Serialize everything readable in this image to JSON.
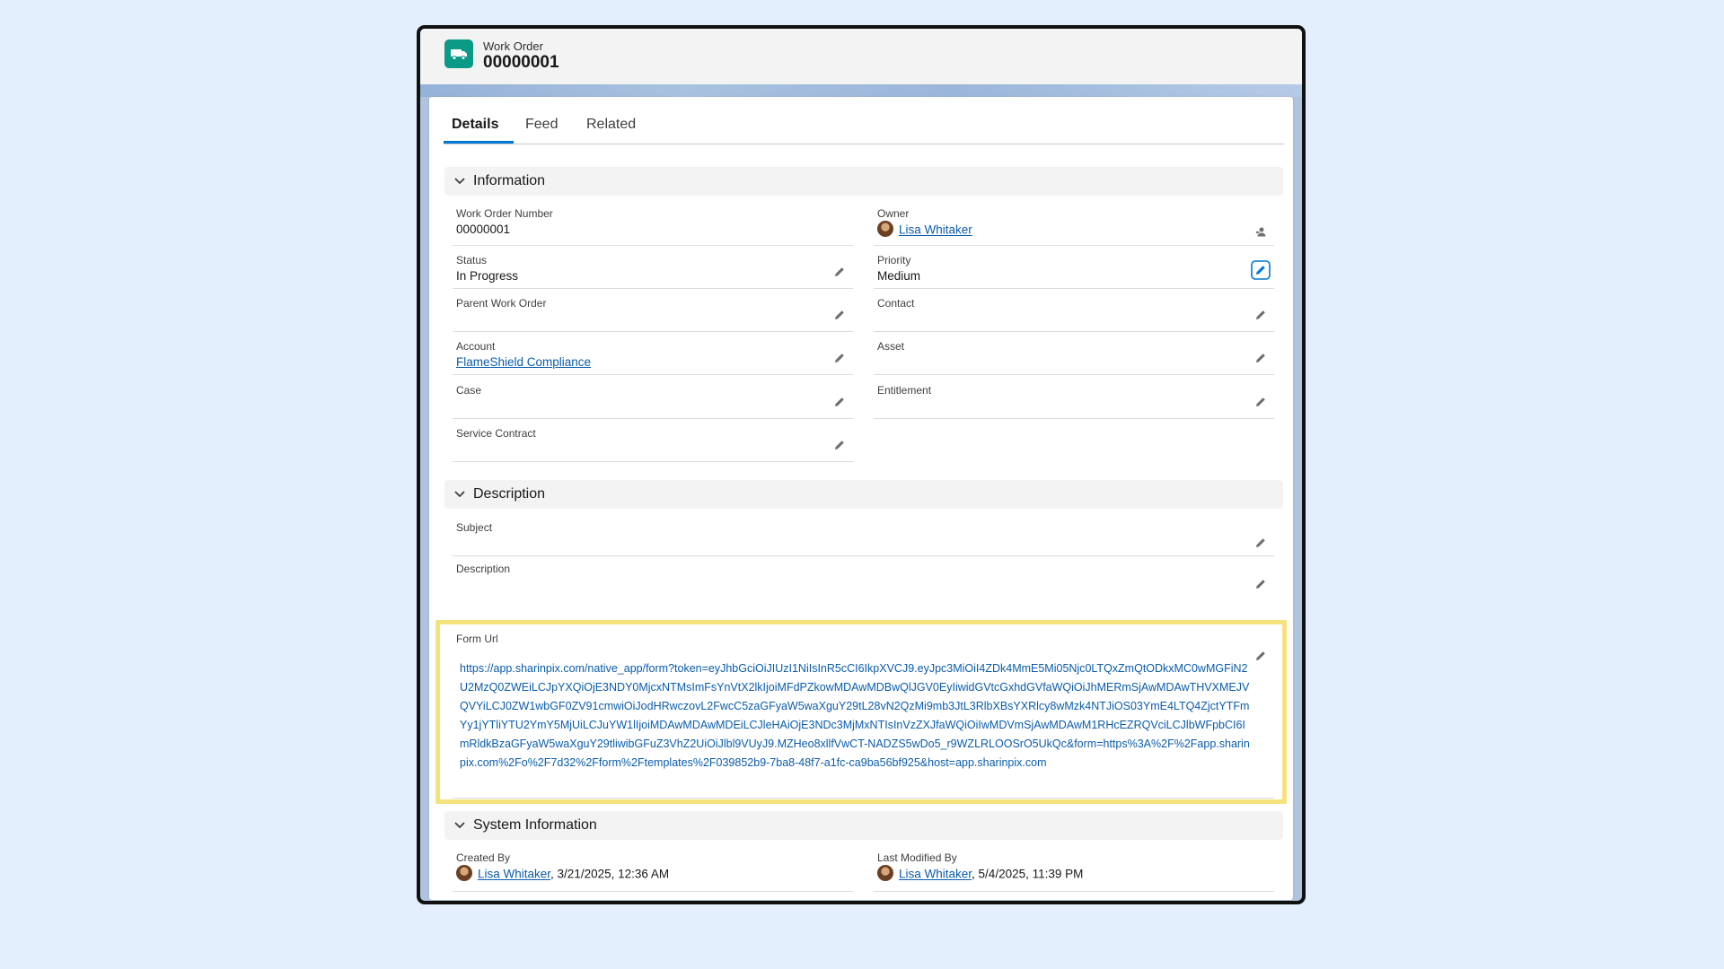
{
  "record": {
    "object_label": "Work Order",
    "title": "00000001"
  },
  "tabs": [
    "Details",
    "Feed",
    "Related"
  ],
  "sections": {
    "information": "Information",
    "description": "Description",
    "system": "System Information"
  },
  "fields": {
    "work_order_number": {
      "label": "Work Order Number",
      "value": "00000001"
    },
    "owner": {
      "label": "Owner",
      "value": "Lisa Whitaker"
    },
    "status": {
      "label": "Status",
      "value": "In Progress"
    },
    "priority": {
      "label": "Priority",
      "value": "Medium"
    },
    "parent_work_order": {
      "label": "Parent Work Order",
      "value": ""
    },
    "contact": {
      "label": "Contact",
      "value": ""
    },
    "account": {
      "label": "Account",
      "value": "FlameShield Compliance"
    },
    "asset": {
      "label": "Asset",
      "value": ""
    },
    "case": {
      "label": "Case",
      "value": ""
    },
    "entitlement": {
      "label": "Entitlement",
      "value": ""
    },
    "service_contract": {
      "label": "Service Contract",
      "value": ""
    },
    "subject": {
      "label": "Subject",
      "value": ""
    },
    "description": {
      "label": "Description",
      "value": ""
    },
    "form_url": {
      "label": "Form Url",
      "value": "https://app.sharinpix.com/native_app/form?token=eyJhbGciOiJIUzI1NiIsInR5cCI6IkpXVCJ9.eyJpc3MiOiI4ZDk4MmE5Mi05Njc0LTQxZmQtODkxMC0wMGFiN2U2MzQ0ZWEiLCJpYXQiOjE3NDY0MjcxNTMsImFsYnVtX2lkIjoiMFdPZkowMDAwMDBwQlJGV0EyIiwidGVtcGxhdGVfaWQiOiJhMERmSjAwMDAwTHVXMEJVQVYiLCJ0ZW1wbGF0ZV91cmwiOiJodHRwczovL2FwcC5zaGFyaW5waXguY29tL28vN2QzMi9mb3JtL3RlbXBsYXRlcy8wMzk4NTJiOS03YmE4LTQ4ZjctYTFmYy1jYTliYTU2YmY5MjUiLCJuYW1lIjoiMDAwMDAwMDEiLCJleHAiOjE3NDc3MjMxNTIsInVzZXJfaWQiOiIwMDVmSjAwMDAwM1RHcEZRQVciLCJlbWFpbCI6ImRldkBzaGFyaW5waXguY29tliwibGFuZ3VhZ2UiOiJlbl9VUyJ9.MZHeo8xllfVwCT-NADZS5wDo5_r9WZLRLOOSrO5UkQc&form=https%3A%2F%2Fapp.sharinpix.com%2Fo%2F7d32%2Fform%2Ftemplates%2F039852b9-7ba8-48f7-a1fc-ca9ba56bf925&host=app.sharinpix.com"
    },
    "created_by": {
      "label": "Created By",
      "user": "Lisa Whitaker",
      "date": ", 3/21/2025, 12:36 AM"
    },
    "last_modified_by": {
      "label": "Last Modified By",
      "user": "Lisa Whitaker",
      "date": ", 5/4/2025, 11:39 PM"
    }
  },
  "icons": {
    "record": "truck-icon",
    "edit": "pencil-icon",
    "change_owner": "change-owner-icon",
    "section_toggle": "chevron-down-icon"
  },
  "colors": {
    "accent": "#0176d3",
    "link": "#0b5cab",
    "record_icon": "#0b9a86",
    "highlight": "#f6e27a",
    "background": "#e3effc"
  }
}
